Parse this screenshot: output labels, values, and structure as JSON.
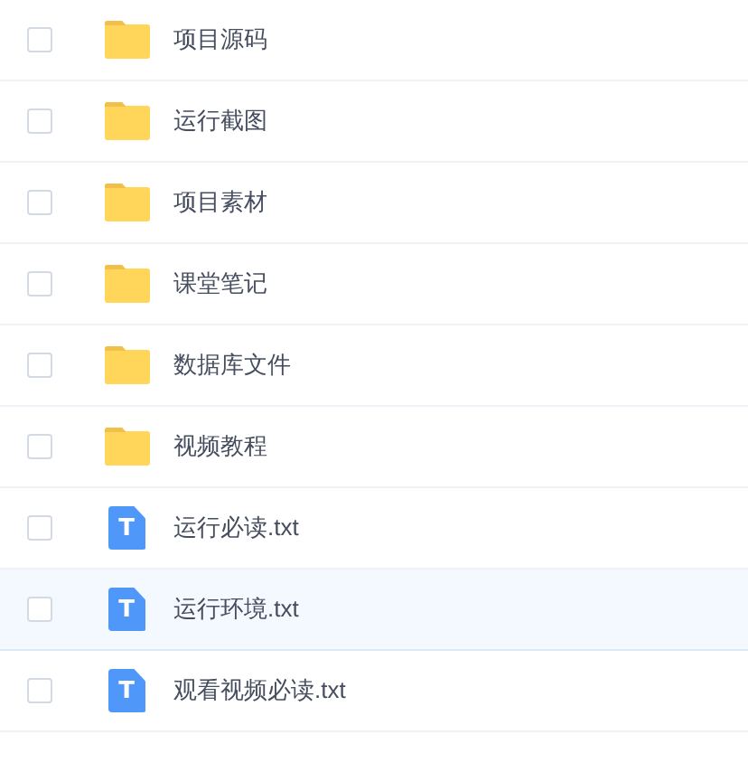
{
  "files": [
    {
      "kind": "folder",
      "name": "项目源码",
      "checked": false,
      "highlighted": false
    },
    {
      "kind": "folder",
      "name": "运行截图",
      "checked": false,
      "highlighted": false
    },
    {
      "kind": "folder",
      "name": "项目素材",
      "checked": false,
      "highlighted": false
    },
    {
      "kind": "folder",
      "name": "课堂笔记",
      "checked": false,
      "highlighted": false
    },
    {
      "kind": "folder",
      "name": "数据库文件",
      "checked": false,
      "highlighted": false
    },
    {
      "kind": "folder",
      "name": "视频教程",
      "checked": false,
      "highlighted": false
    },
    {
      "kind": "file",
      "name": "运行必读.txt",
      "icon_text": "T",
      "checked": false,
      "highlighted": false
    },
    {
      "kind": "file",
      "name": "运行环境.txt",
      "icon_text": "T",
      "checked": false,
      "highlighted": true
    },
    {
      "kind": "file",
      "name": "观看视频必读.txt",
      "icon_text": "T",
      "checked": false,
      "highlighted": false
    }
  ]
}
